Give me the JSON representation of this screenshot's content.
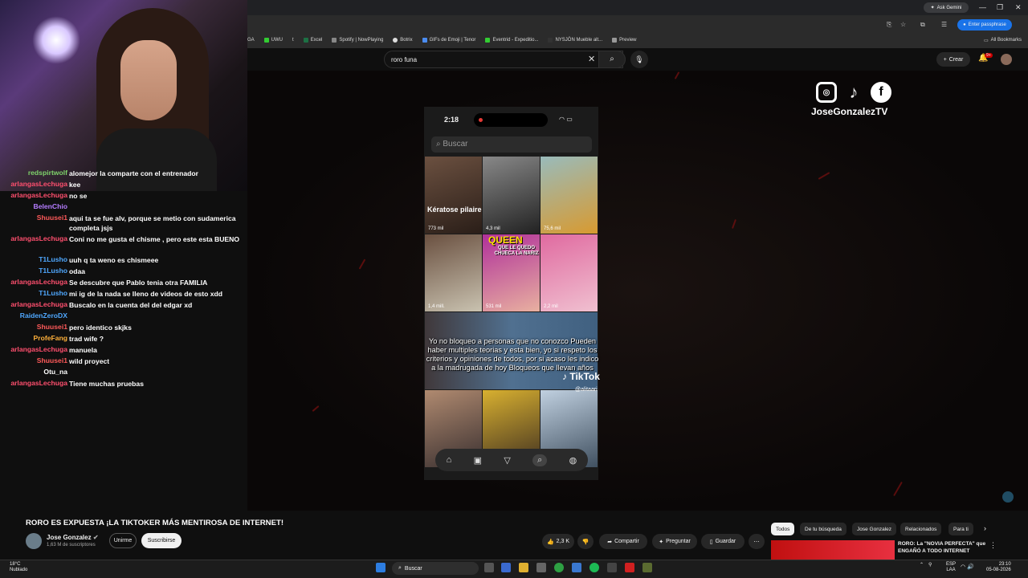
{
  "browser": {
    "gemini_label": "Ask Gemini",
    "passphrase_label": "Enter passphrase",
    "all_bookmarks": "All Bookmarks",
    "bookmarks": [
      "GA",
      "UWU",
      "t",
      "Excel",
      "Spotify | NowPlaying",
      "Botrix",
      "GIFs de Emoji | Tenor",
      "Eventrid - Expeditio...",
      "NYSJÖN Mueble alt...",
      "Preview"
    ],
    "window_controls": [
      "—",
      "❐",
      "✕"
    ]
  },
  "youtube": {
    "search_value": "roro funa",
    "create_label": "Crear",
    "notif_count": "9+",
    "video_title": "RORO ES EXPUESTA ¡LA TIKTOKER MÁS MENTIROSA DE INTERNET!",
    "channel_name": "Jose Gonzalez",
    "subscribers": "1,63 M de suscriptores",
    "join_label": "Unirme",
    "subscribe_label": "Suscribirse",
    "like_count": "2,3 K",
    "share_label": "Compartir",
    "ask_label": "Preguntar",
    "save_label": "Guardar",
    "chips": [
      "Todos",
      "De tu búsqueda",
      "Jose Gonzalez",
      "Relacionados",
      "Para ti"
    ],
    "reco_title": "RORO: La \"NOVIA PERFECTA\" que ENGAÑÓ A TODO INTERNET"
  },
  "overlay": {
    "channel_tag": "JoseGonzalezTV",
    "social_icons": [
      "instagram-icon",
      "tiktok-icon",
      "facebook-icon"
    ]
  },
  "phone": {
    "time": "2:18",
    "search_placeholder": "Buscar",
    "tiles": [
      {
        "views": "773 mil"
      },
      {
        "views": "4,3 mil"
      },
      {
        "views": "75,6 mil"
      },
      {
        "views": "1,4 mill."
      },
      {
        "views": "531 mil"
      },
      {
        "views": "2,2 mil"
      }
    ],
    "keratose": "Kératose pilaire",
    "queen": "QUEEN",
    "queen_sub": "QUE LE QUEDO CHUECA LA NARIZ",
    "caption": "Yo no bloqueo a personas que no conozco Pueden haber multiples teorias y esta bien, yo si respeto los criterios y opiniones de todos, por si acaso les indico a la madrugada de hoy Bloqueos que llevan años",
    "watermark": "TikTok",
    "tiktok_user": "@alitaari"
  },
  "chat": [
    {
      "user": "redspirtwolf",
      "color": "#7fd36b",
      "text": "alomejor la comparte con el entrenador"
    },
    {
      "user": "arlangasLechuga",
      "color": "#ff4f6e",
      "text": "kee"
    },
    {
      "user": "arlangasLechuga",
      "color": "#ff4f6e",
      "text": "no se"
    },
    {
      "user": "BelenChio",
      "color": "#b57dff",
      "text": ""
    },
    {
      "user": "Shuusei1",
      "color": "#ff5a5a",
      "text": "aqui ta se fue alv, porque se metio con sudamerica completa jsjs"
    },
    {
      "user": "arlangasLechuga",
      "color": "#ff4f6e",
      "text": "Coni no me gusta el chisme , pero este esta BUENO"
    },
    {
      "user": "T1Lusho",
      "color": "#4fa8ff",
      "text": "uuh q ta weno es chismeee"
    },
    {
      "user": "T1Lusho",
      "color": "#4fa8ff",
      "text": "odaa"
    },
    {
      "user": "arlangasLechuga",
      "color": "#ff4f6e",
      "text": "Se descubre que Pablo tenia otra FAMILIA"
    },
    {
      "user": "T1Lusho",
      "color": "#4fa8ff",
      "text": "mi ig de la nada se lleno de videos de esto xdd"
    },
    {
      "user": "arlangasLechuga",
      "color": "#ff4f6e",
      "text": "Buscalo en la cuenta del del edgar xd"
    },
    {
      "user": "RaidenZeroDX",
      "color": "#4fa8ff",
      "text": ""
    },
    {
      "user": "Shuusei1",
      "color": "#ff5a5a",
      "text": "pero identico skjks"
    },
    {
      "user": "ProfeFang",
      "color": "#ffb13b",
      "text": "trad wife ?"
    },
    {
      "user": "arlangasLechuga",
      "color": "#ff4f6e",
      "text": "manuela"
    },
    {
      "user": "Shuusei1",
      "color": "#ff5a5a",
      "text": "wild proyect"
    },
    {
      "user": "Otu_na",
      "color": "#ffffff",
      "text": ""
    },
    {
      "user": "arlangasLechuga",
      "color": "#ff4f6e",
      "text": "Tiene muchas pruebas"
    }
  ],
  "taskbar": {
    "weather_temp": "18°C",
    "weather_desc": "Nublado",
    "search_label": "Buscar",
    "lang": "ESP",
    "lang2": "LAA",
    "time": "23:10",
    "date": "05-08-2026"
  }
}
